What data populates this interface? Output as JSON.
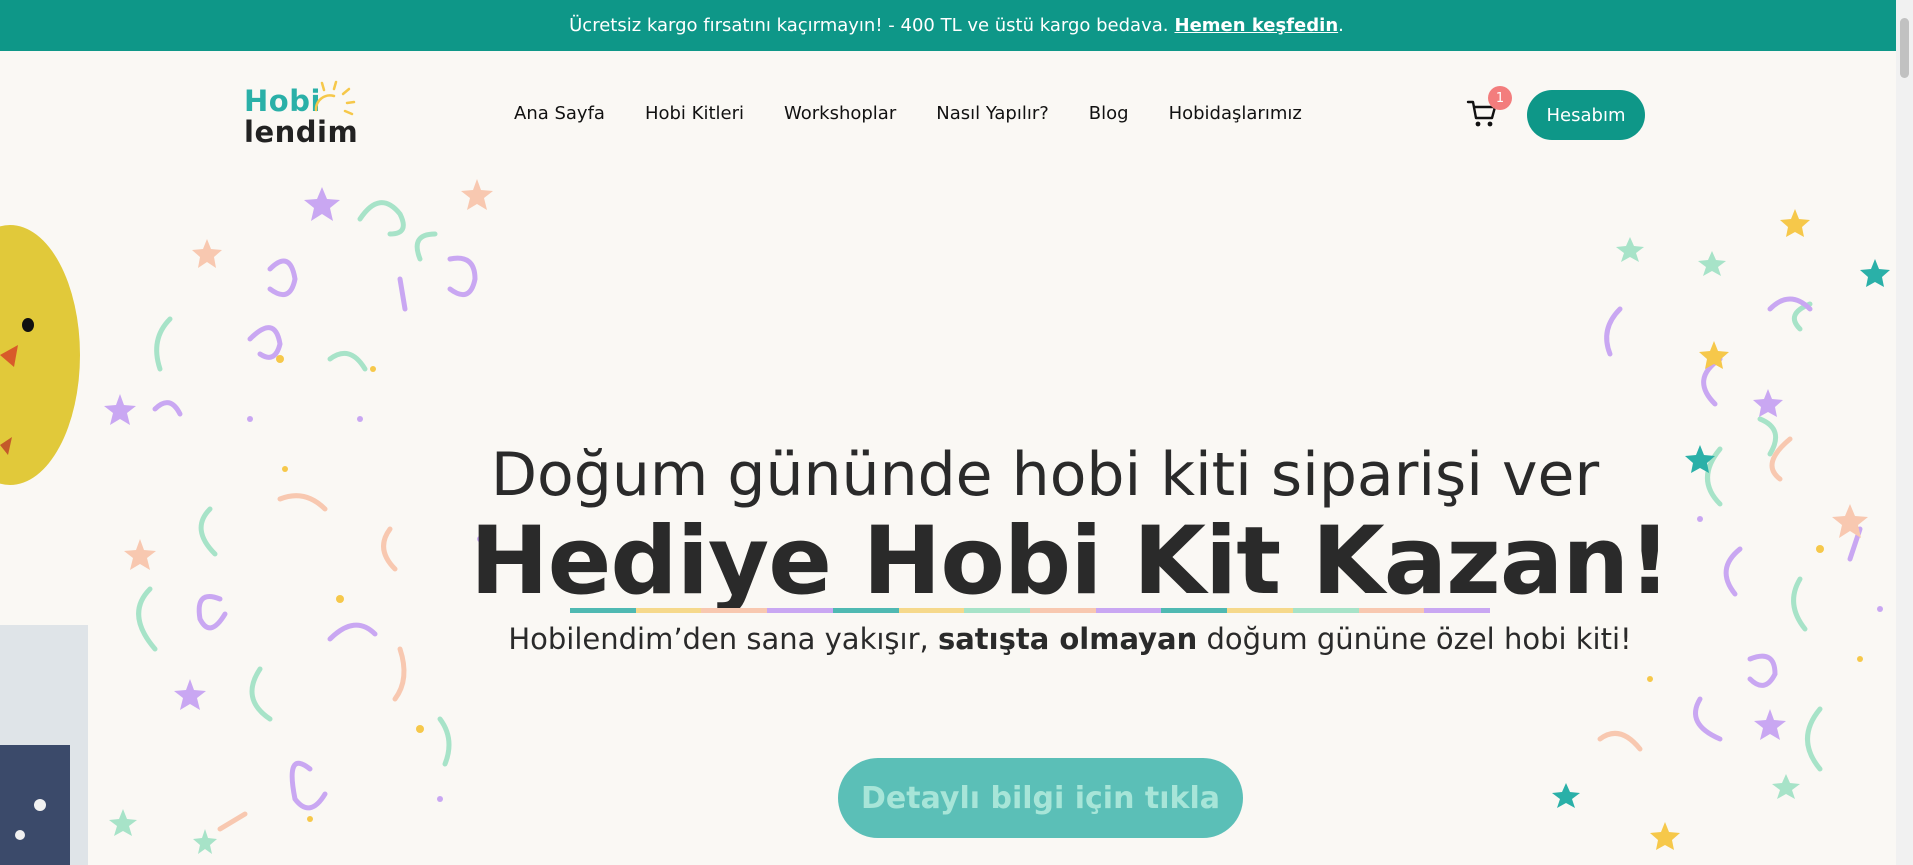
{
  "announcement": {
    "text": "Ücretsiz kargo fırsatını kaçırmayın! - 400 TL ve üstü kargo bedava.",
    "link_label": "Hemen keşfedin",
    "trailing": "."
  },
  "logo": {
    "line1": "Hobi",
    "line2": "lendim"
  },
  "nav": {
    "items": [
      {
        "label": "Ana Sayfa"
      },
      {
        "label": "Hobi Kitleri"
      },
      {
        "label": "Workshoplar"
      },
      {
        "label": "Nasıl Yapılır?"
      },
      {
        "label": "Blog"
      },
      {
        "label": "Hobidaşlarımız"
      }
    ]
  },
  "cart": {
    "icon": "cart-icon",
    "count": "1"
  },
  "account": {
    "label": "Hesabım"
  },
  "hero": {
    "line1": "Doğum gününde hobi kiti siparişi ver",
    "line2": "Hediye Hobi Kit Kazan!",
    "sub_before": "Hobilendim’den sana yakışır, ",
    "sub_bold": "satışta olmayan",
    "sub_after": " doğum gününe özel hobi kiti!",
    "cta": "Detaylı bilgi için tıkla"
  },
  "colors": {
    "brand": "#0e9788",
    "accent": "#5bbfb7",
    "badge": "#f37d7d",
    "underline": [
      "#4fb9b2",
      "#f6d98b",
      "#f8c8b0",
      "#c9a7f2",
      "#a7e3c8"
    ]
  }
}
